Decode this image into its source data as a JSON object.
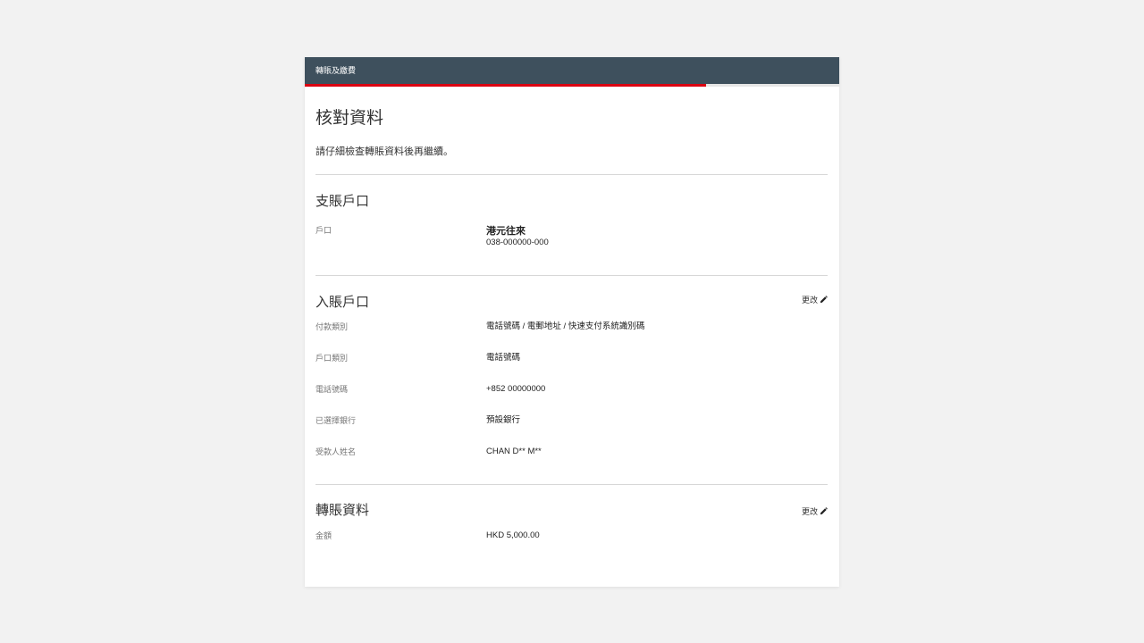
{
  "header": {
    "title": "轉賬及繳費",
    "progress_percent": 75
  },
  "page": {
    "title": "核對資料",
    "subtitle": "請仔細檢查轉賬資料後再繼續。"
  },
  "from_account": {
    "title": "支賬戶口",
    "label": "戶口",
    "account_name": "港元往來",
    "account_number": "038-000000-000"
  },
  "to_account": {
    "title": "入賬戶口",
    "edit_label": "更改",
    "rows": [
      {
        "label": "付款類別",
        "value": "電話號碼 / 電郵地址 / 快速支付系統識別碼"
      },
      {
        "label": "戶口類別",
        "value": "電話號碼"
      },
      {
        "label": "電話號碼",
        "value": "+852 00000000"
      },
      {
        "label": "已選擇銀行",
        "value": "預設銀行"
      },
      {
        "label": "受款人姓名",
        "value": "CHAN D** M**"
      }
    ]
  },
  "transfer_details": {
    "title": "轉賬資料",
    "edit_label": "更改",
    "rows": [
      {
        "label": "金額",
        "value": "HKD 5,000.00"
      }
    ]
  },
  "colors": {
    "header_bg": "#3e505d",
    "accent": "#db0011"
  }
}
